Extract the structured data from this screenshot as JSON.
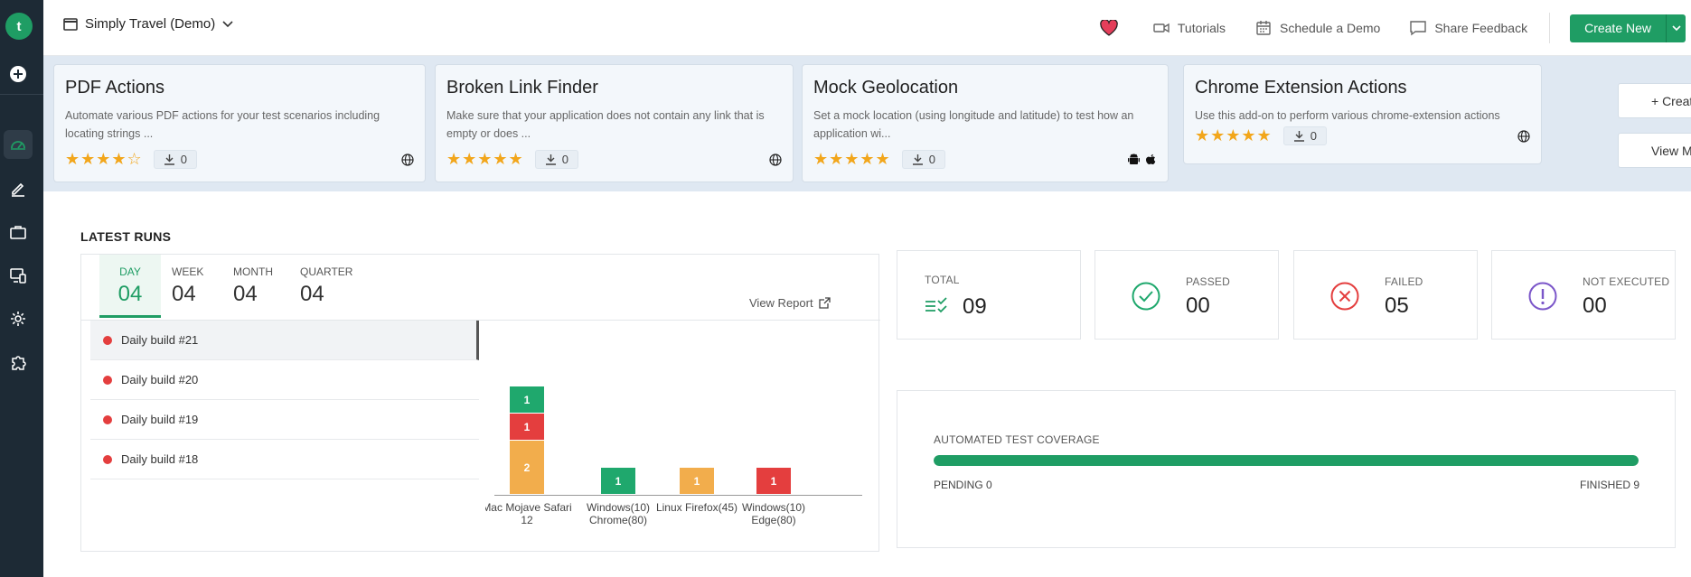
{
  "header": {
    "project_name": "Simply Travel (Demo)",
    "tutorials": "Tutorials",
    "schedule_demo": "Schedule a Demo",
    "share_feedback": "Share Feedback",
    "create_new": "Create New"
  },
  "addons": [
    {
      "title": "PDF Actions",
      "description": "Automate various PDF actions for your test scenarios including locating strings ...",
      "stars": "★★★★☆",
      "downloads": "0",
      "platform_icons": [
        "globe-icon"
      ]
    },
    {
      "title": "Broken Link Finder",
      "description": "Make sure that your application does not contain any link that is empty or does ...",
      "stars": "★★★★★",
      "downloads": "0",
      "platform_icons": [
        "globe-icon"
      ]
    },
    {
      "title": "Mock Geolocation",
      "description": "Set a mock location (using longitude and latitude) to test how an application wi...",
      "stars": "★★★★★",
      "downloads": "0",
      "platform_icons": [
        "android-icon",
        "apple-icon"
      ]
    },
    {
      "title": "Chrome Extension Actions",
      "description": "Use this add-on to perform various chrome-extension actions",
      "stars": "★★★★★",
      "downloads": "0",
      "platform_icons": [
        "globe-icon"
      ]
    }
  ],
  "addon_actions": {
    "create_addon": "+ Create Addon",
    "view_more": "View More..."
  },
  "latest_runs": {
    "title": "LATEST RUNS",
    "tabs": [
      {
        "label": "DAY",
        "value": "04"
      },
      {
        "label": "WEEK",
        "value": "04"
      },
      {
        "label": "MONTH",
        "value": "04"
      },
      {
        "label": "QUARTER",
        "value": "04"
      }
    ],
    "view_report": "View Report",
    "builds": [
      "Daily build #21",
      "Daily build #20",
      "Daily build #19",
      "Daily build #18"
    ]
  },
  "stats": {
    "total": {
      "label": "TOTAL",
      "value": "09"
    },
    "passed": {
      "label": "PASSED",
      "value": "00"
    },
    "failed": {
      "label": "FAILED",
      "value": "05"
    },
    "not_executed": {
      "label": "NOT EXECUTED",
      "value": "00"
    }
  },
  "coverage": {
    "title": "AUTOMATED TEST COVERAGE",
    "pending": "PENDING 0",
    "finished": "FINISHED 9",
    "progress": 1.0
  },
  "colors": {
    "accent": "#1f9d64",
    "passed": "#1fa86d",
    "failed": "#e43e3e",
    "not_executed": "#f2ad4c",
    "sidebar": "#1d2a35"
  },
  "chart_data": {
    "type": "bar",
    "stacked": true,
    "categories": [
      "Mac Mojave Safari 12",
      "Windows(10) Chrome(80)",
      "Linux Firefox(45)",
      "Windows(10) Edge(80)"
    ],
    "series": [
      {
        "values": [
          2,
          0,
          1,
          0
        ],
        "color": "#f2ad4c"
      },
      {
        "values": [
          1,
          0,
          0,
          1
        ],
        "color": "#e43e3e"
      },
      {
        "values": [
          1,
          1,
          0,
          0
        ],
        "color": "#1fa86d"
      }
    ],
    "ylim": [
      0,
      4
    ]
  }
}
